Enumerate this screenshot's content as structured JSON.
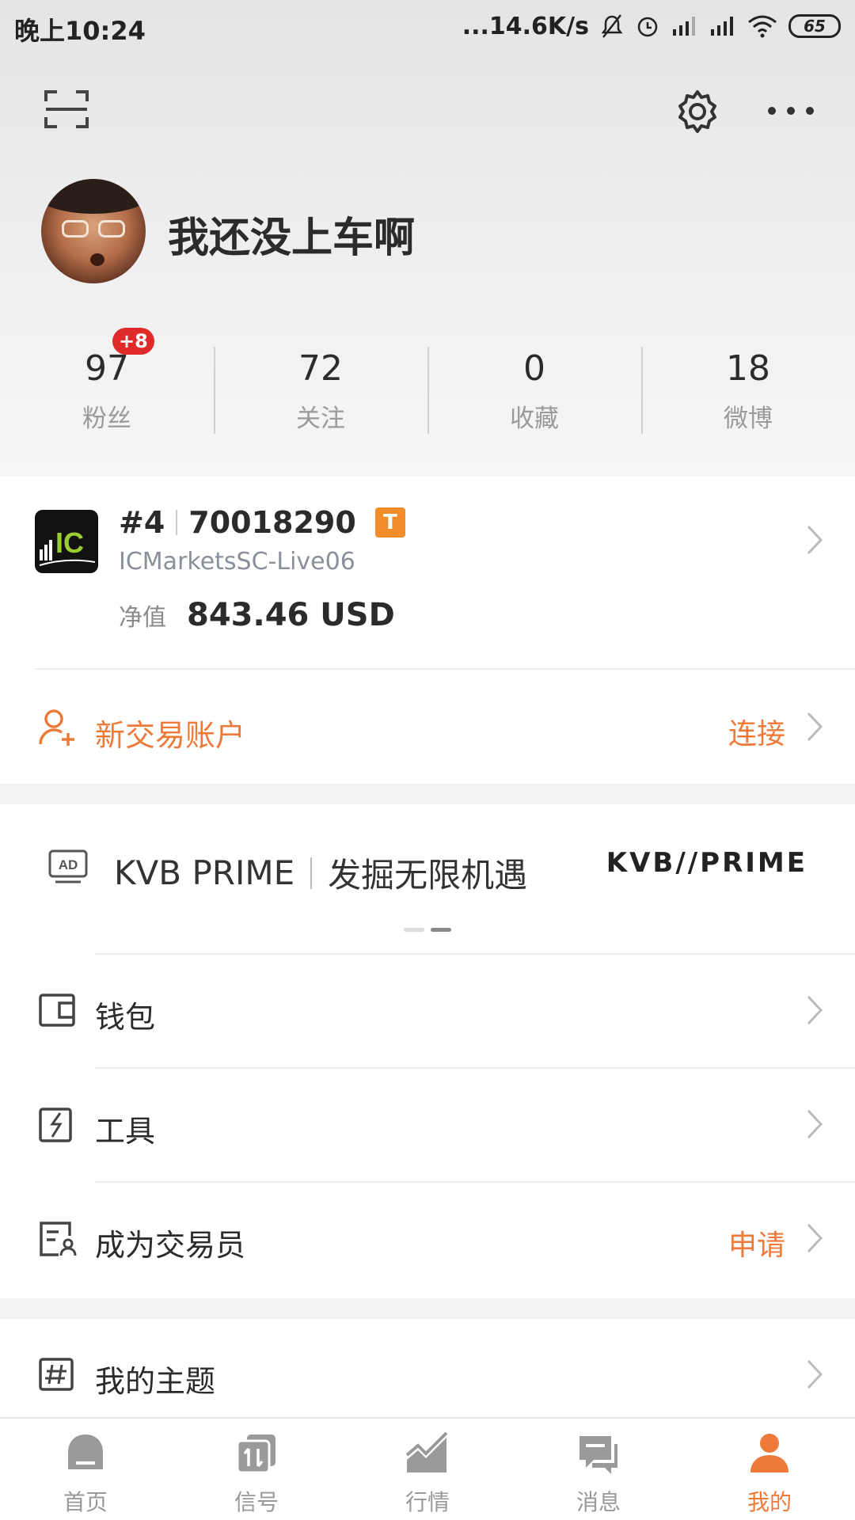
{
  "status_bar": {
    "time": "晚上10:24",
    "net_speed": "...14.6K/s",
    "battery": "65"
  },
  "profile": {
    "username": "我还没上车啊"
  },
  "stats": [
    {
      "value": "97",
      "label": "粉丝",
      "badge": "+8"
    },
    {
      "value": "72",
      "label": "关注"
    },
    {
      "value": "0",
      "label": "收藏"
    },
    {
      "value": "18",
      "label": "微博"
    }
  ],
  "account": {
    "logo_text": "IC",
    "rank": "#4",
    "number": "70018290",
    "type_badge": "T",
    "server": "ICMarketsSC-Live06",
    "equity_label": "净值",
    "equity_value": "843.46 USD"
  },
  "new_account": {
    "label": "新交易账户",
    "action": "连接"
  },
  "ad": {
    "tag": "AD",
    "brand_text": "KVB PRIME",
    "slogan": "发掘无限机遇",
    "brand_logo": "KVB//PRIME"
  },
  "menu": {
    "wallet": "钱包",
    "tools": "工具",
    "become_trader": "成为交易员",
    "become_trader_action": "申请",
    "my_topics": "我的主题"
  },
  "tabs": [
    {
      "label": "首页"
    },
    {
      "label": "信号"
    },
    {
      "label": "行情"
    },
    {
      "label": "消息"
    },
    {
      "label": "我的",
      "active": true
    }
  ],
  "colors": {
    "accent": "#ee7a3a",
    "badge_red": "#e02a2a",
    "type_badge": "#f08c2a"
  }
}
